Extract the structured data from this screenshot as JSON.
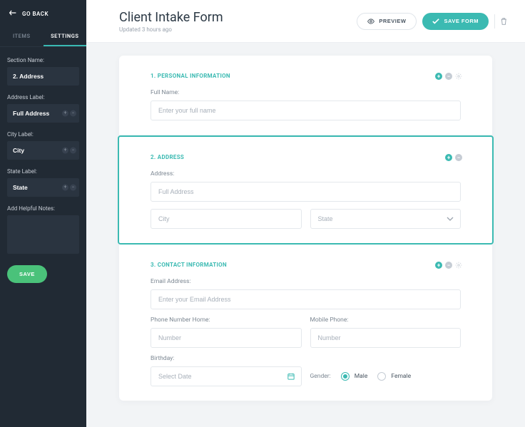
{
  "sidebar": {
    "go_back": "GO BACK",
    "tabs": {
      "items": "ITEMS",
      "settings": "SETTINGS"
    },
    "section_name_label": "Section Name:",
    "section_name_value": "2. Address",
    "address_label_label": "Address Label:",
    "address_label_value": "Full Address",
    "city_label_label": "City Label:",
    "city_label_value": "City",
    "state_label_label": "State Label:",
    "state_label_value": "State",
    "notes_label": "Add Helpful Notes:",
    "save": "SAVE"
  },
  "header": {
    "title": "Client Intake Form",
    "subtitle": "Updated 3 hours ago",
    "preview": "PREVIEW",
    "save_form": "SAVE FORM"
  },
  "sections": {
    "s1": {
      "title": "1. PERSONAL INFORMATION",
      "full_name_label": "Full Name:",
      "full_name_placeholder": "Enter your full name"
    },
    "s2": {
      "title": "2. ADDRESS",
      "address_label": "Address:",
      "address_placeholder": "Full Address",
      "city_placeholder": "City",
      "state_placeholder": "State"
    },
    "s3": {
      "title": "3. CONTACT INFORMATION",
      "email_label": "Email Address:",
      "email_placeholder": "Enter your Email Address",
      "home_label": "Phone Number Home:",
      "home_placeholder": "Number",
      "mobile_label": "Mobile Phone:",
      "mobile_placeholder": "Number",
      "birthday_label": "Birthday:",
      "birthday_placeholder": "Select Date",
      "gender_label": "Gender:",
      "gender_male": "Male",
      "gender_female": "Female"
    }
  }
}
